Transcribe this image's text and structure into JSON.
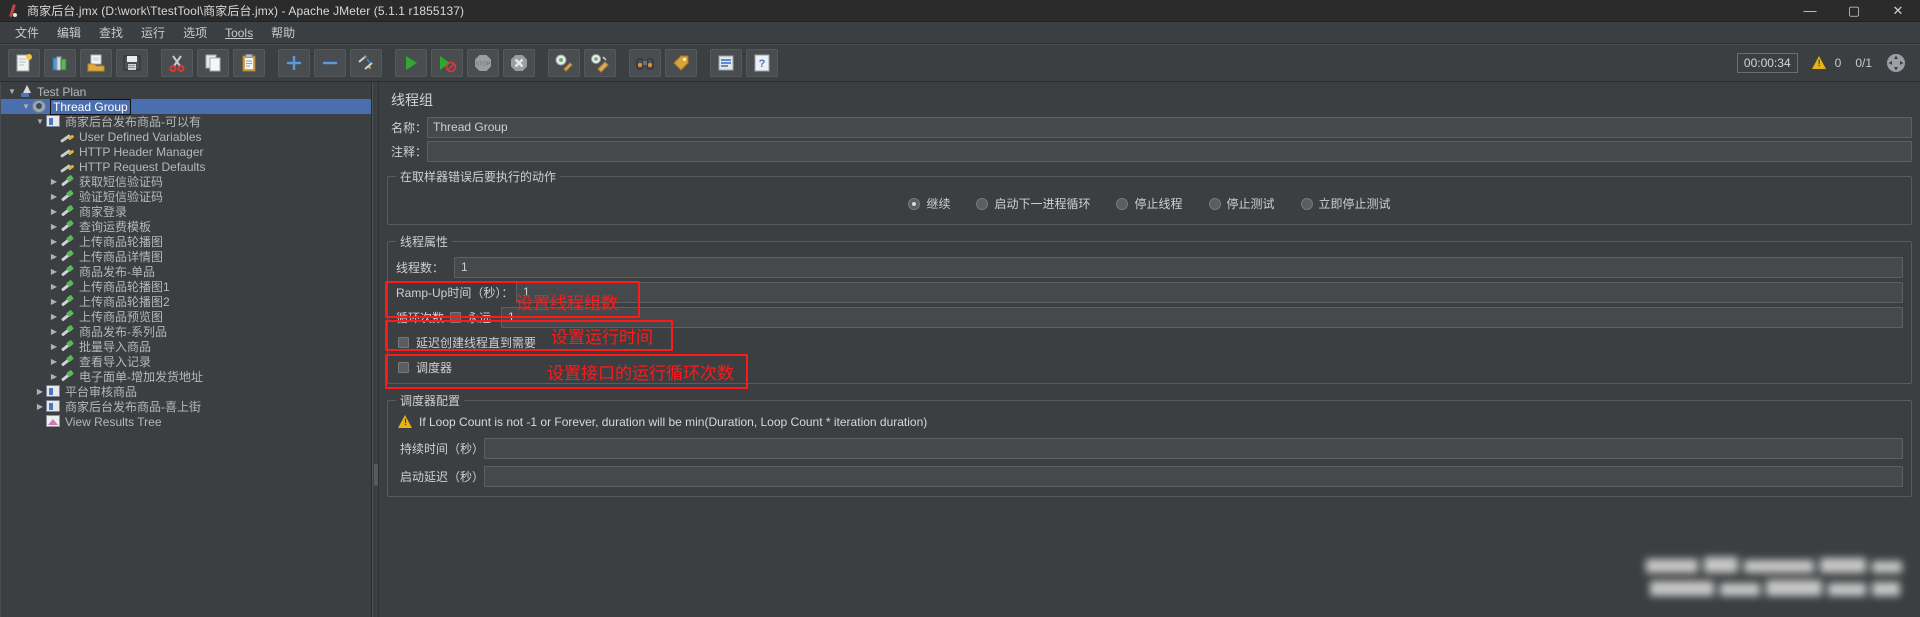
{
  "window": {
    "title": "商家后台.jmx (D:\\work\\TtestTool\\商家后台.jmx) - Apache JMeter (5.1.1 r1855137)",
    "minimize": "—",
    "maximize": "▢",
    "close": "✕",
    "app_icon": "jmeter-feather-icon"
  },
  "menubar": {
    "items": [
      {
        "label": "文件",
        "name": "menu-file"
      },
      {
        "label": "编辑",
        "name": "menu-edit"
      },
      {
        "label": "查找",
        "name": "menu-search"
      },
      {
        "label": "运行",
        "name": "menu-run"
      },
      {
        "label": "选项",
        "name": "menu-options"
      },
      {
        "label": "Tools",
        "name": "menu-tools"
      },
      {
        "label": "帮助",
        "name": "menu-help"
      }
    ]
  },
  "toolbar": {
    "buttons": [
      {
        "name": "new-test-plan-button",
        "icon": "new-document-icon"
      },
      {
        "name": "templates-button",
        "icon": "templates-books-icon"
      },
      {
        "name": "open-button",
        "icon": "open-folder-icon"
      },
      {
        "name": "save-button",
        "icon": "floppy-save-icon"
      },
      {
        "name": "cut-button",
        "icon": "scissors-icon"
      },
      {
        "name": "copy-button",
        "icon": "copy-pages-icon"
      },
      {
        "name": "paste-button",
        "icon": "clipboard-paste-icon"
      },
      {
        "name": "expand-all-button",
        "icon": "plus-icon"
      },
      {
        "name": "collapse-all-button",
        "icon": "minus-icon"
      },
      {
        "name": "toggle-button",
        "icon": "toggle-pencils-icon"
      },
      {
        "name": "start-button",
        "icon": "green-play-icon"
      },
      {
        "name": "start-no-pauses-button",
        "icon": "play-no-pause-icon"
      },
      {
        "name": "stop-button",
        "icon": "stop-sign-icon"
      },
      {
        "name": "shutdown-button",
        "icon": "shutdown-x-icon"
      },
      {
        "name": "clear-button",
        "icon": "gear-broom-icon"
      },
      {
        "name": "clear-all-button",
        "icon": "gear-broom-all-icon"
      },
      {
        "name": "search-button",
        "icon": "binoculars-icon"
      },
      {
        "name": "reset-search-button",
        "icon": "reset-search-tag-icon"
      },
      {
        "name": "function-helper-button",
        "icon": "function-helper-icon"
      },
      {
        "name": "help-button",
        "icon": "question-help-icon"
      }
    ],
    "status": {
      "elapsed_time": "00:00:34",
      "warning_icon": "warning-triangle-icon",
      "warning_count": "0",
      "threads": "0/1",
      "expand_icon": "expand-arrows-icon"
    }
  },
  "tree": {
    "nodes": [
      {
        "label": "Test Plan",
        "indent": 0,
        "arrow": "▼",
        "icon": "test-plan-icon",
        "name": "tree-node-test-plan",
        "selected": false
      },
      {
        "label": "Thread Group",
        "indent": 1,
        "arrow": "▼",
        "icon": "thread-group-icon",
        "name": "tree-node-thread-group",
        "selected": true
      },
      {
        "label": "商家后台发布商品-可以有",
        "indent": 2,
        "arrow": "▼",
        "icon": "controller-icon",
        "name": "tree-node-controller-1",
        "selected": false
      },
      {
        "label": "User Defined Variables",
        "indent": 3,
        "arrow": "",
        "icon": "config-element-icon",
        "name": "tree-node-user-defined-variables",
        "selected": false
      },
      {
        "label": "HTTP Header Manager",
        "indent": 3,
        "arrow": "",
        "icon": "config-element-icon",
        "name": "tree-node-http-header-manager",
        "selected": false
      },
      {
        "label": "HTTP Request Defaults",
        "indent": 3,
        "arrow": "",
        "icon": "config-element-icon",
        "name": "tree-node-http-request-defaults",
        "selected": false
      },
      {
        "label": "获取短信验证码",
        "indent": 3,
        "arrow": "▶",
        "icon": "sampler-icon",
        "name": "tree-node-sampler-1",
        "selected": false
      },
      {
        "label": "验证短信验证码",
        "indent": 3,
        "arrow": "▶",
        "icon": "sampler-icon",
        "name": "tree-node-sampler-2",
        "selected": false
      },
      {
        "label": "商家登录",
        "indent": 3,
        "arrow": "▶",
        "icon": "sampler-icon",
        "name": "tree-node-sampler-3",
        "selected": false
      },
      {
        "label": "查询运费模板",
        "indent": 3,
        "arrow": "▶",
        "icon": "sampler-icon",
        "name": "tree-node-sampler-4",
        "selected": false
      },
      {
        "label": "上传商品轮播图",
        "indent": 3,
        "arrow": "▶",
        "icon": "sampler-icon",
        "name": "tree-node-sampler-5",
        "selected": false
      },
      {
        "label": "上传商品详情图",
        "indent": 3,
        "arrow": "▶",
        "icon": "sampler-icon",
        "name": "tree-node-sampler-6",
        "selected": false
      },
      {
        "label": "商品发布-单品",
        "indent": 3,
        "arrow": "▶",
        "icon": "sampler-icon",
        "name": "tree-node-sampler-7",
        "selected": false
      },
      {
        "label": "上传商品轮播图1",
        "indent": 3,
        "arrow": "▶",
        "icon": "sampler-icon",
        "name": "tree-node-sampler-8",
        "selected": false
      },
      {
        "label": "上传商品轮播图2",
        "indent": 3,
        "arrow": "▶",
        "icon": "sampler-icon",
        "name": "tree-node-sampler-9",
        "selected": false
      },
      {
        "label": "上传商品预览图",
        "indent": 3,
        "arrow": "▶",
        "icon": "sampler-icon",
        "name": "tree-node-sampler-10",
        "selected": false
      },
      {
        "label": "商品发布-系列品",
        "indent": 3,
        "arrow": "▶",
        "icon": "sampler-icon",
        "name": "tree-node-sampler-11",
        "selected": false
      },
      {
        "label": "批量导入商品",
        "indent": 3,
        "arrow": "▶",
        "icon": "sampler-icon",
        "name": "tree-node-sampler-12",
        "selected": false
      },
      {
        "label": "查看导入记录",
        "indent": 3,
        "arrow": "▶",
        "icon": "sampler-icon",
        "name": "tree-node-sampler-13",
        "selected": false
      },
      {
        "label": "电子面单-增加发货地址",
        "indent": 3,
        "arrow": "▶",
        "icon": "sampler-icon",
        "name": "tree-node-sampler-14",
        "selected": false
      },
      {
        "label": "平台审核商品",
        "indent": 2,
        "arrow": "▶",
        "icon": "controller-icon",
        "name": "tree-node-controller-2",
        "selected": false
      },
      {
        "label": "商家后台发布商品-喜上街",
        "indent": 2,
        "arrow": "▶",
        "icon": "controller-icon",
        "name": "tree-node-controller-3",
        "selected": false
      },
      {
        "label": "View Results Tree",
        "indent": 2,
        "arrow": "",
        "icon": "listener-icon",
        "name": "tree-node-view-results-tree",
        "selected": false
      }
    ]
  },
  "main": {
    "panel_title": "线程组",
    "name_label": "名称：",
    "name_value": "Thread Group",
    "comment_label": "注释：",
    "comment_value": "",
    "on_error": {
      "legend": "在取样器错误后要执行的动作",
      "options": [
        {
          "label": "继续",
          "selected": true,
          "name": "radio-continue"
        },
        {
          "label": "启动下一进程循环",
          "selected": false,
          "name": "radio-start-next-loop"
        },
        {
          "label": "停止线程",
          "selected": false,
          "name": "radio-stop-thread"
        },
        {
          "label": "停止测试",
          "selected": false,
          "name": "radio-stop-test"
        },
        {
          "label": "立即停止测试",
          "selected": false,
          "name": "radio-stop-test-now"
        }
      ]
    },
    "thread_properties": {
      "legend": "线程属性",
      "threads_label": "线程数：",
      "threads_value": "1",
      "rampup_label": "Ramp-Up时间（秒）：",
      "rampup_value": "1",
      "loop_label": "循环次数",
      "forever_label": "永远",
      "forever_checked": false,
      "loop_value": "1",
      "delay_thread_label": "延迟创建线程直到需要",
      "delay_thread_checked": false,
      "scheduler_label": "调度器",
      "scheduler_checked": false
    },
    "scheduler": {
      "legend": "调度器配置",
      "warning_icon": "warning-triangle-icon",
      "warning_text": "If Loop Count is not -1 or Forever, duration will be min(Duration, Loop Count * iteration duration)",
      "duration_label": "持续时间（秒）",
      "duration_value": "",
      "startup_delay_label": "启动延迟（秒）",
      "startup_delay_value": ""
    }
  },
  "annotations": {
    "color": "#ff1a1a",
    "items": [
      {
        "text": "设置线程组数",
        "name": "annotation-thread-count"
      },
      {
        "text": "设置运行时间",
        "name": "annotation-ramp-up"
      },
      {
        "text": "设置接口的运行循环次数",
        "name": "annotation-loop-count"
      }
    ]
  }
}
